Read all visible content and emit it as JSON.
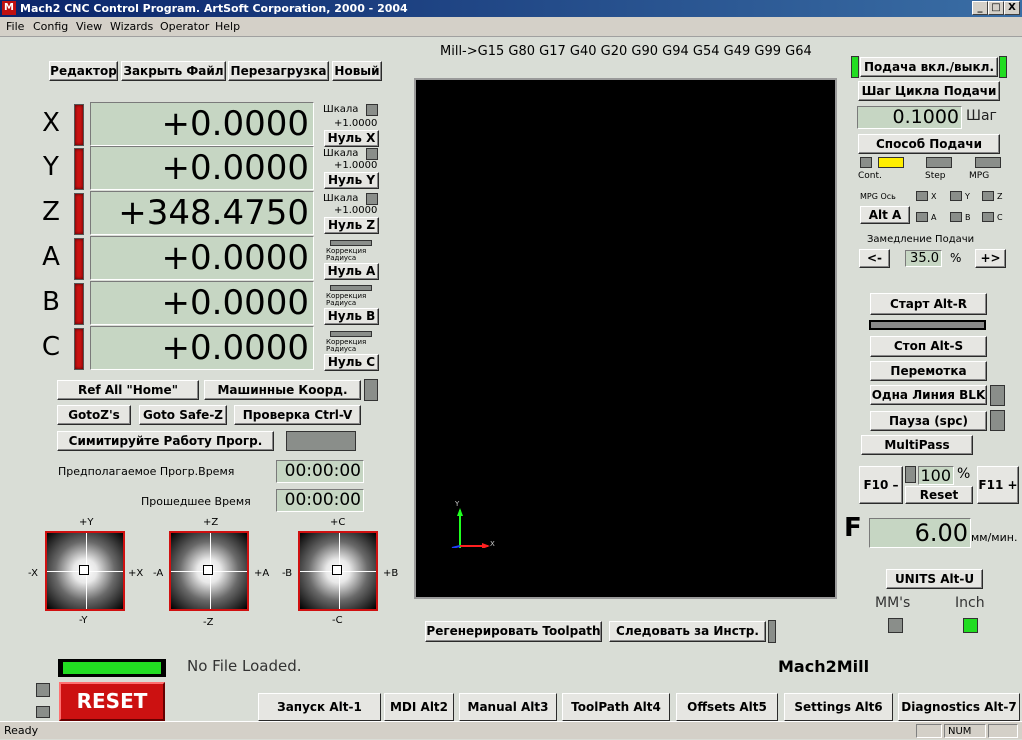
{
  "window": {
    "title": "Mach2 CNC Control Program. ArtSoft Corporation, 2000 - 2004",
    "logo_letter": "M",
    "minimize": "_",
    "maximize": "□",
    "close": "X"
  },
  "menu": [
    "File",
    "Config",
    "View",
    "Wizards",
    "Operator",
    "Help"
  ],
  "gcode_state": "Mill->G15  G80 G17 G40 G20 G90 G94 G54 G49 G99 G64",
  "top_buttons": [
    "Редактор",
    "Закрыть Файл",
    "Перезагрузка",
    "Новый"
  ],
  "axes": [
    {
      "name": "X",
      "value": "+0.0000",
      "scale_label": "Шкала",
      "scale_value": "+1.0000",
      "zero": "Нуль X"
    },
    {
      "name": "Y",
      "value": "+0.0000",
      "scale_label": "Шкала",
      "scale_value": "+1.0000",
      "zero": "Нуль Y"
    },
    {
      "name": "Z",
      "value": "+348.4750",
      "scale_label": "Шкала",
      "scale_value": "+1.0000",
      "zero": "Нуль Z"
    },
    {
      "name": "A",
      "value": "+0.0000",
      "corr_label": "Коррекция Радиуса",
      "zero": "Нуль A"
    },
    {
      "name": "B",
      "value": "+0.0000",
      "corr_label": "Коррекция Радиуса",
      "zero": "Нуль B"
    },
    {
      "name": "C",
      "value": "+0.0000",
      "corr_label": "Коррекция Радиуса",
      "zero": "Нуль C"
    }
  ],
  "ref_buttons": {
    "ref_all": "Ref All \"Home\"",
    "machine_coords": "Машинные Коорд.",
    "gotoz": "GotoZ's",
    "goto_safe": "Goto Safe-Z",
    "check": "Проверка Ctrl-V",
    "simulate": "Симитируйте Работу Прогр."
  },
  "times": {
    "estimated_label": "Предполагаемое Прогр.Время",
    "estimated_value": "00:00:00",
    "elapsed_label": "Прошедшее Время",
    "elapsed_value": "00:00:00"
  },
  "jog_pads": [
    {
      "up": "+Y",
      "down": "-Y",
      "left": "-X",
      "right": "+X"
    },
    {
      "up": "+Z",
      "down": "-Z",
      "left": "-A",
      "right": "+A"
    },
    {
      "up": "+C",
      "down": "-C",
      "left": "-B",
      "right": "+B"
    }
  ],
  "toolpath": {
    "regen": "Регенерировать Toolpath",
    "follow": "Следовать за Инстр.",
    "axis_y": "Y",
    "axis_x": "X"
  },
  "file_status": "No File Loaded.",
  "brand": "Mach2Mill",
  "reset_label": "RESET",
  "jog_panel": {
    "toggle": "Подача вкл./выкл.",
    "step_cycle": "Шаг Цикла Подачи",
    "step_value": "0.1000",
    "step_unit": "Шаг",
    "mode_button": "Способ Подачи",
    "modes": [
      "Cont.",
      "Step",
      "MPG"
    ],
    "mpg_axis_label": "MPG Ось",
    "mpg_axes": [
      "X",
      "Y",
      "Z",
      "A",
      "B",
      "C"
    ],
    "alt_a": "Alt A",
    "slow_label": "Замедление Подачи",
    "slow_minus": "<-",
    "slow_plus": "+>",
    "slow_value": "35.0",
    "slow_unit": "%"
  },
  "cycle": {
    "start": "Старт Alt-R",
    "stop": "Стоп Alt-S",
    "rewind": "Перемотка",
    "single": "Одна Линия BLK",
    "pause": "Пауза (spc)",
    "multipass": "MultiPass"
  },
  "feed": {
    "f10": "F10 –",
    "f11": "F11 +",
    "override": "100",
    "override_unit": "%",
    "reset": "Reset",
    "f_label": "F",
    "feed_value": "6.00",
    "feed_unit": "мм/мин."
  },
  "units": {
    "button": "UNITS Alt-U",
    "mm": "MM's",
    "inch": "Inch"
  },
  "tabs": [
    "Запуск Alt-1",
    "MDI Alt2",
    "Manual Alt3",
    "ToolPath Alt4",
    "Offsets Alt5",
    "Settings Alt6",
    "Diagnostics Alt-7"
  ],
  "status": {
    "text": "Ready",
    "num": "NUM"
  },
  "colors": {
    "background": "#d9ddd6",
    "dro": "#c6d6c3",
    "led_red": "#cc1111",
    "led_green": "#22dd22",
    "led_yellow": "#ffee00",
    "toolpath_bg": "#000000"
  }
}
